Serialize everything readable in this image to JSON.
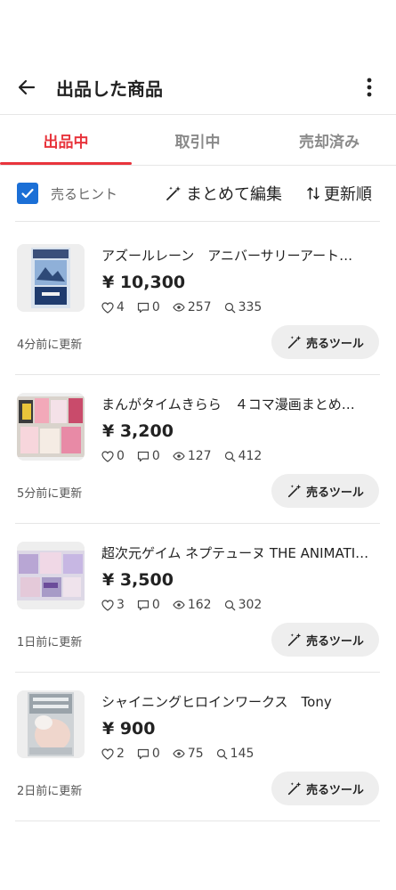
{
  "header": {
    "title": "出品した商品",
    "back_icon": "arrow-left-icon",
    "more_icon": "more-vertical-icon"
  },
  "tabs": [
    {
      "label": "出品中",
      "active": true
    },
    {
      "label": "取引中",
      "active": false
    },
    {
      "label": "売却済み",
      "active": false
    }
  ],
  "toolbar": {
    "hint_label": "売るヒント",
    "hint_checked": true,
    "bulk_edit_label": "まとめて編集",
    "sort_label": "更新順"
  },
  "items": [
    {
      "title": "アズールレーン　アニバーサリーアート…",
      "price": "¥ 10,300",
      "likes": "4",
      "comments": "0",
      "views": "257",
      "searches": "335",
      "updated": "4分前に更新",
      "tool_label": "売るツール"
    },
    {
      "title": "まんがタイムきらら　４コマ漫画まとめ…",
      "price": "¥ 3,200",
      "likes": "0",
      "comments": "0",
      "views": "127",
      "searches": "412",
      "updated": "5分前に更新",
      "tool_label": "売るツール"
    },
    {
      "title": "超次元ゲイム ネプテューヌ THE ANIMATI…",
      "price": "¥ 3,500",
      "likes": "3",
      "comments": "0",
      "views": "162",
      "searches": "302",
      "updated": "1日前に更新",
      "tool_label": "売るツール"
    },
    {
      "title": "シャイニングヒロインワークス　Tony",
      "price": "¥ 900",
      "likes": "2",
      "comments": "0",
      "views": "75",
      "searches": "145",
      "updated": "2日前に更新",
      "tool_label": "売るツール"
    }
  ],
  "colors": {
    "accent": "#e8343c",
    "checkbox": "#1b6fd6"
  }
}
